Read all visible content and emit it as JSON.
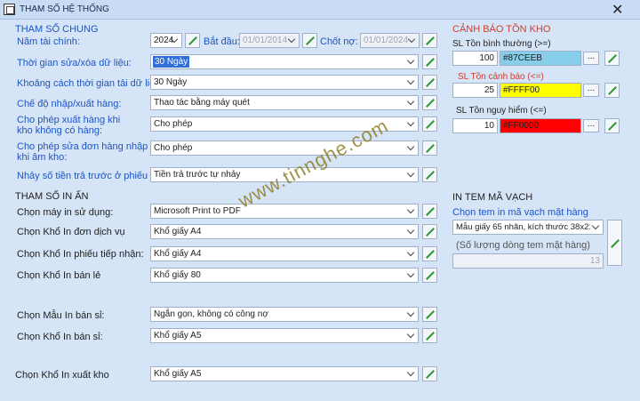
{
  "window": {
    "title": "THAM SỐ HỆ THỐNG",
    "close_glyph": "✕"
  },
  "general": {
    "section_title": "THAM SỐ CHUNG",
    "fiscal_year_label": "Năm tài chính:",
    "fiscal_year_value": "2024",
    "start_label": "Bắt đầu:",
    "start_value": "01/01/2014",
    "lock_label": "Chốt nợ:",
    "lock_value": "01/01/2024",
    "edit_time_label": "Thời gian sửa/xóa dữ liệu:",
    "edit_time_value": "30 Ngày",
    "reload_label": "Khoảng cách thời gian tải dữ liệu:",
    "reload_value": "30 Ngày",
    "io_mode_label": "Chế độ nhập/xuất hàng:",
    "io_mode_value": "Thao tác bằng máy quét",
    "export_no_stock_label_1": "Cho phép xuất hàng khi",
    "export_no_stock_label_2": "kho không có hàng:",
    "export_no_stock_value": "Cho phép",
    "edit_negative_label_1": "Cho phép sửa đơn hàng nhập",
    "edit_negative_label_2": "khi âm kho:",
    "edit_negative_value": "Cho phép",
    "jump_label": "Nhảy số tiền trả trước ở phiếu sỉ:",
    "jump_value": "Tiền trả trước tự nhảy"
  },
  "print": {
    "section_title": "THAM SỐ IN ẤN",
    "printer_label": "Chọn máy in sử dụng:",
    "printer_value": "Microsoft Print to PDF",
    "service_size_label": "Chọn Khổ In đơn dịch vụ",
    "service_size_value": "Khổ giấy A4",
    "receipt_size_label": "Chọn Khổ In phiếu tiếp nhận:",
    "receipt_size_value": "Khổ giấy A4",
    "retail_size_label": "Chọn Khổ In bán lẻ",
    "retail_size_value": "Khổ giấy 80",
    "wholesale_tpl_label": "Chọn Mẫu In bán sỉ:",
    "wholesale_tpl_value": "Ngắn gọn, không có công nợ",
    "wholesale_size_label": "Chọn Khổ In bán sỉ:",
    "wholesale_size_value": "Khổ giấy A5",
    "export_size_label": "Chọn Khổ In xuất kho",
    "export_size_value": "Khổ giấy A5"
  },
  "stock_alert": {
    "section_title": "CẢNH BÁO TỒN KHO",
    "normal_label": "SL Tồn bình thường (>=)",
    "normal_value": "100",
    "normal_color_text": "#87CEEB",
    "normal_color": "#87CEEB",
    "warn_label": "SL Tồn cảnh báo (<=)",
    "warn_value": "25",
    "warn_color_text": "#FFFF00",
    "warn_color": "#FFFF00",
    "danger_label": "SL Tồn nguy hiểm (<=)",
    "danger_value": "10",
    "danger_color_text": "#FF0000",
    "danger_color": "#FF0000",
    "dots": "..."
  },
  "barcode": {
    "section_title": "IN TEM MÃ VẠCH",
    "template_label": "Chọn tem in mã vạch mặt hàng",
    "template_value": "Mẫu giấy 65 nhãn, kích thước 38x21 (Kh",
    "count_label": "(Số lượng dòng tem mặt hàng)",
    "count_value": "13"
  },
  "watermark": "www.tinnghe.com",
  "colors": {
    "label_blue": "#1C55C4",
    "label_red": "#D23C2C",
    "window_bg": "#D6E4F7"
  }
}
